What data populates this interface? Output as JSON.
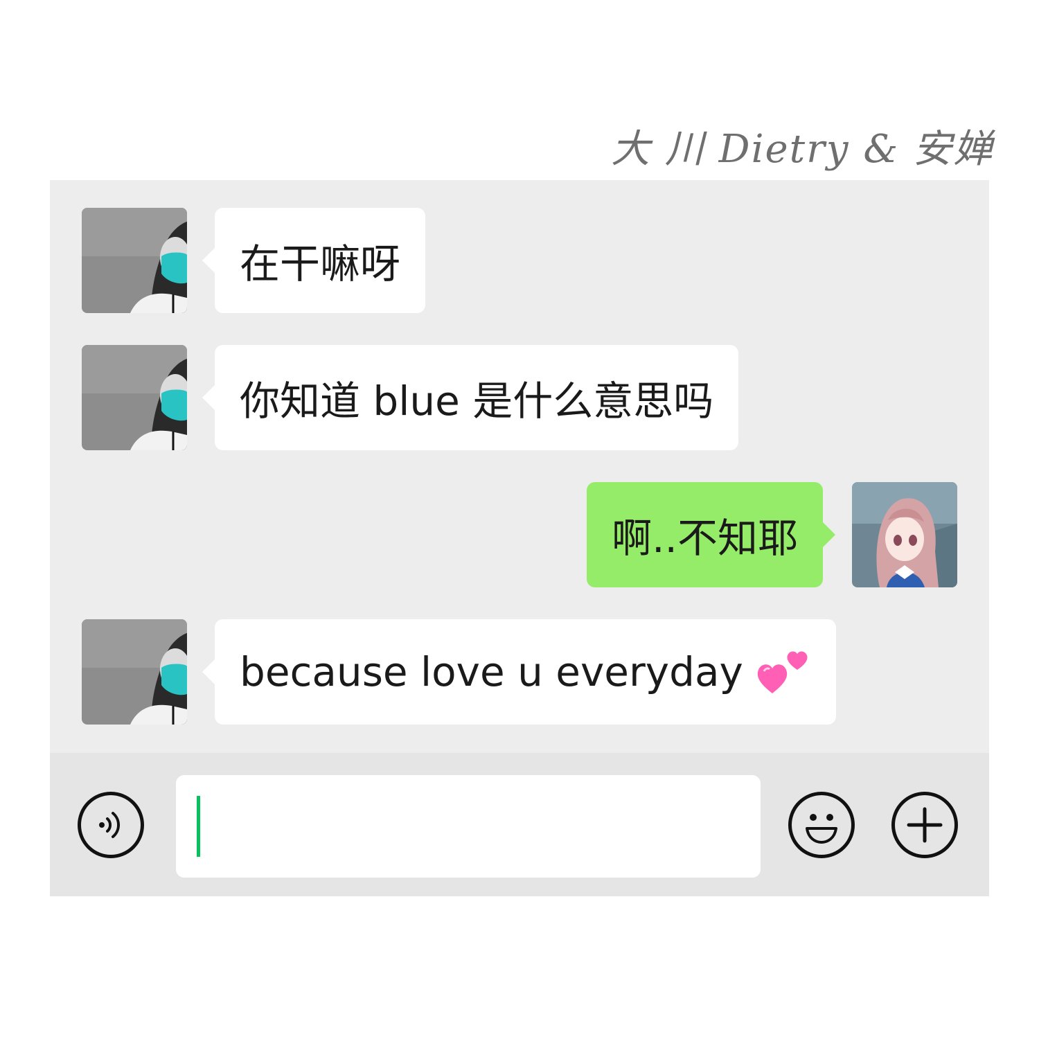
{
  "credit": "大 川 Dietry & 安婵",
  "messages": [
    {
      "sender": "other",
      "text": "在干嘛呀"
    },
    {
      "sender": "other",
      "text": "你知道 blue 是什么意思吗"
    },
    {
      "sender": "self",
      "text": "啊..不知耶"
    },
    {
      "sender": "other",
      "text": "because  love u everyday"
    }
  ],
  "emoji": "two-hearts-emoji",
  "input": {
    "value": ""
  },
  "icons": {
    "voice": "voice-icon",
    "emoji": "smiley-icon",
    "more": "plus-icon"
  },
  "colors": {
    "chat_bg": "#ededed",
    "incoming_bubble": "#ffffff",
    "outgoing_bubble": "#95ec69",
    "input_bar": "#e5e5e5",
    "caret": "#07c160"
  }
}
